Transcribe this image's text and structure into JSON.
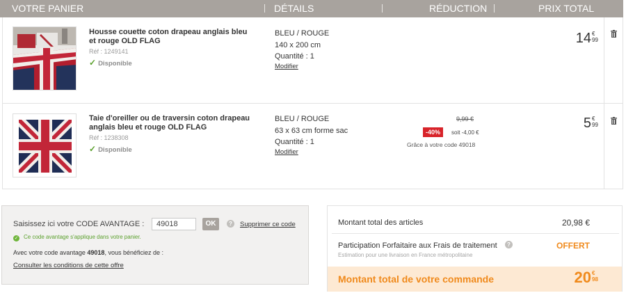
{
  "header": {
    "col_cart": "VOTRE PANIER",
    "col_details": "DÉTAILS",
    "col_reduction": "RÉDUCTION",
    "col_total": "PRIX TOTAL"
  },
  "items": [
    {
      "name": "Housse couette coton drapeau anglais bleu et rouge OLD FLAG",
      "ref": "Réf : 1249141",
      "availability": "Disponible",
      "color": "BLEU / ROUGE",
      "size": "140 x 200 cm",
      "quantity": "Quantité : 1",
      "modify": "Modifier",
      "price_int": "14",
      "price_currency": "€",
      "price_cents": "99"
    },
    {
      "name": "Taie d'oreiller ou de traversin coton drapeau anglais bleu et rouge OLD FLAG",
      "ref": "Réf : 1238308",
      "availability": "Disponible",
      "color": "BLEU / ROUGE",
      "size": "63 x 63 cm forme sac",
      "quantity": "Quantité : 1",
      "modify": "Modifier",
      "old_price": "9,99 €",
      "discount_badge": "-40%",
      "discount_amount": "soit -4,00 €",
      "discount_note": "Grâce à votre code 49018",
      "price_int": "5",
      "price_currency": "€",
      "price_cents": "99"
    }
  ],
  "promo": {
    "label": "Saisissez ici votre CODE AVANTAGE :",
    "code_value": "49018",
    "ok_label": "OK",
    "help": "?",
    "remove_link": "Supprimer ce code",
    "applied_message": "Ce code avantage s'applique dans votre panier.",
    "benefit_prefix": "Avec votre code avantage ",
    "benefit_code": "49018",
    "benefit_suffix": ", vous bénéficiez de :",
    "conditions_link": "Consulter les conditions de cette offre"
  },
  "totals": {
    "articles_label": "Montant total des articles",
    "articles_value": "20,98 €",
    "fees_label": "Participation Forfaitaire aux Frais de traitement",
    "fees_help": "?",
    "fees_value": "OFFERT",
    "fees_note": "Estimation pour une livraison en France métropolitaine",
    "grand_label": "Montant total de votre commande",
    "grand_int": "20",
    "grand_currency": "€",
    "grand_cents": "98"
  },
  "colors": {
    "header_bg": "#a8a39e",
    "accent_orange": "#f08a1c",
    "discount_red": "#d8232a",
    "available_green": "#5aa02c"
  }
}
